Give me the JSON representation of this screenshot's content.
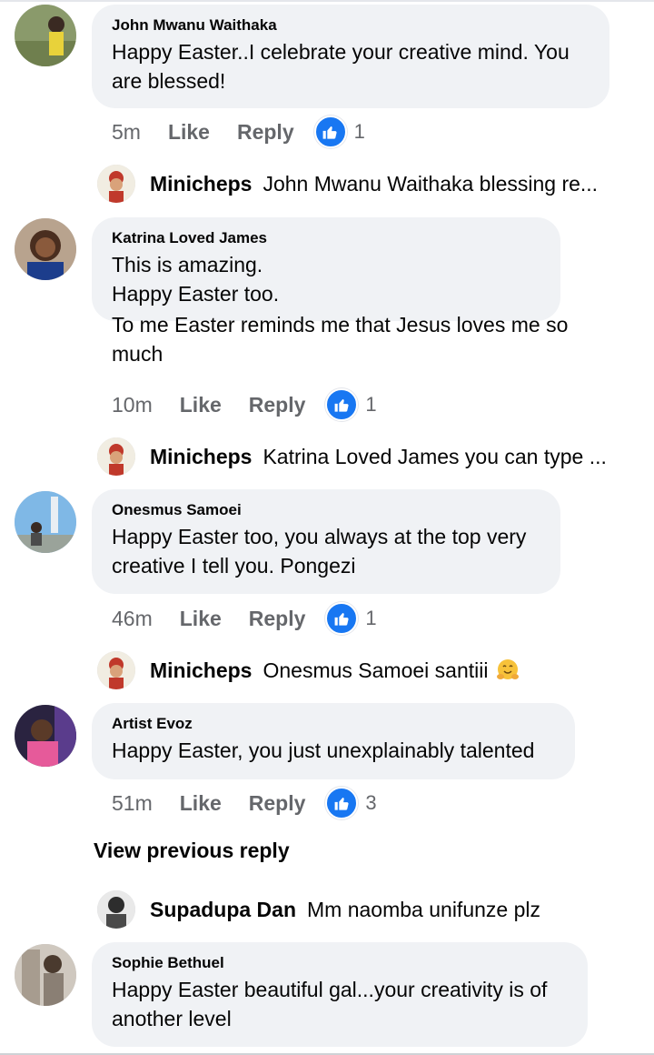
{
  "comments": [
    {
      "author": "John Mwanu Waithaka",
      "text_lines": [
        "Happy Easter..I celebrate your creative mind. You",
        "are blessed!"
      ],
      "time": "5m",
      "like": "Like",
      "reply": "Reply",
      "reactions": "1",
      "reply_preview": {
        "author": "Minicheps",
        "text": "John Mwanu Waithaka blessing re..."
      }
    },
    {
      "author": "Katrina Loved James",
      "text_lines": [
        "This is amazing.",
        "Happy Easter too.",
        "To me Easter reminds me that Jesus loves me so",
        "much"
      ],
      "time": "10m",
      "like": "Like",
      "reply": "Reply",
      "reactions": "1",
      "reply_preview": {
        "author": "Minicheps",
        "text": "Katrina Loved James you can type ..."
      }
    },
    {
      "author": "Onesmus Samoei",
      "text_lines": [
        "Happy Easter too, you always at the top very",
        "creative I tell you. Pongezi"
      ],
      "time": "46m",
      "like": "Like",
      "reply": "Reply",
      "reactions": "1",
      "reply_preview": {
        "author": "Minicheps",
        "text": "Onesmus Samoei santiii"
      }
    },
    {
      "author": "Artist Evoz",
      "text_lines": [
        "Happy Easter, you just unexplainably talented"
      ],
      "time": "51m",
      "like": "Like",
      "reply": "Reply",
      "reactions": "3",
      "view_previous": "View previous reply",
      "reply_preview": {
        "author": "Supadupa Dan",
        "text": "Mm naomba unifunze plz"
      }
    },
    {
      "author": "Sophie Bethuel",
      "text_lines": [
        "Happy Easter beautiful gal...your creativity is of",
        "another level"
      ]
    }
  ],
  "icons": {
    "like": "thumbs-up-icon",
    "emoji": "hugging-face-icon"
  },
  "colors": {
    "bubble": "#f0f2f5",
    "like_blue": "#1877f2",
    "meta_gray": "#65676b"
  }
}
